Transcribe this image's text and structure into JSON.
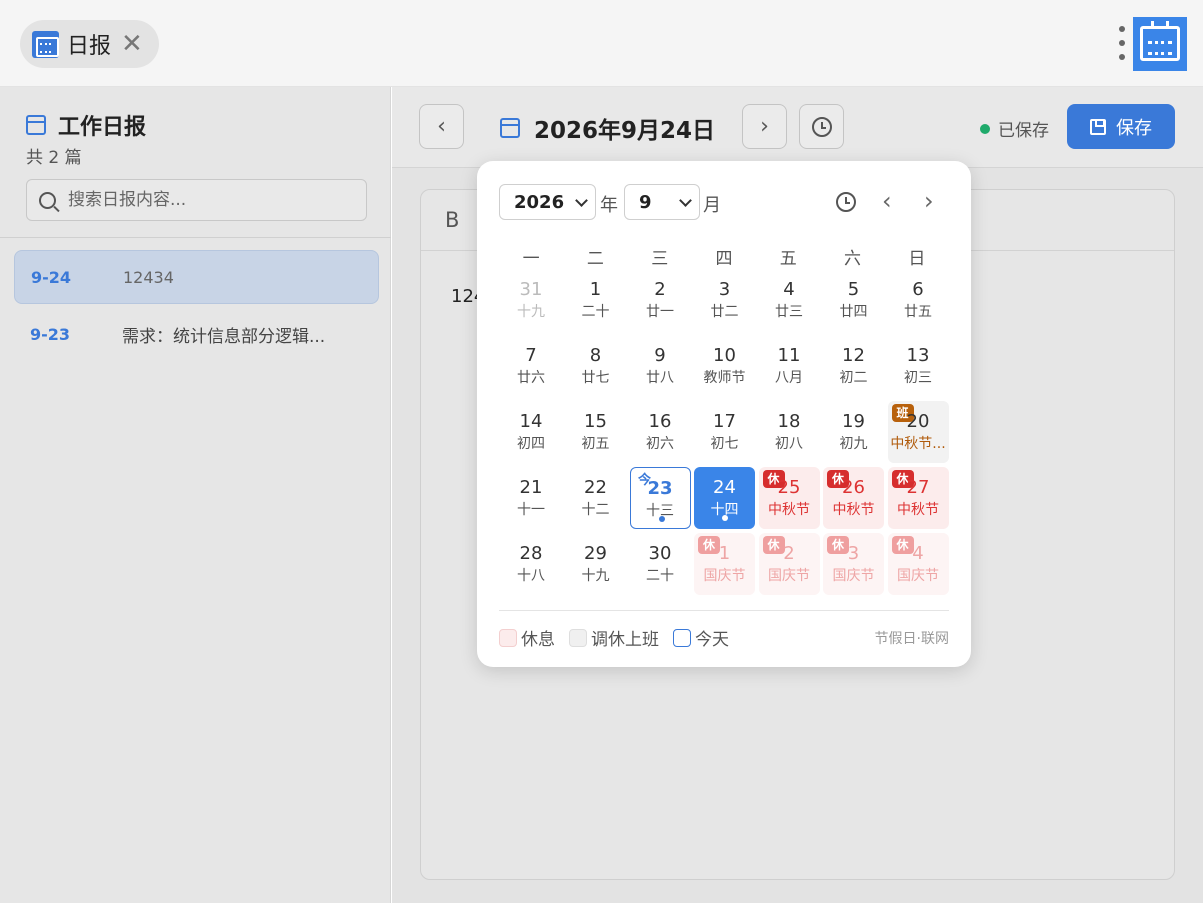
{
  "titlebar": {
    "tab_label": "日报",
    "close_glyph": "✕",
    "logo_icon": "calendar-icon"
  },
  "sidebar": {
    "title": "工作日报",
    "count": "共 2 篇",
    "search_placeholder": "搜索日报内容...",
    "items": [
      {
        "date": "9-24",
        "summary": "12434",
        "active": true
      },
      {
        "date": "9-23",
        "summary": "需求：统计信息部分逻辑...",
        "active": false
      }
    ]
  },
  "toolbar": {
    "prev_glyph": "‹",
    "next_glyph": "›",
    "current_date": "2026年9月24日",
    "saved_status": "已保存",
    "save_label": "保存"
  },
  "editor": {
    "bold_button": "B",
    "content_preview": "124"
  },
  "calendar": {
    "year": "2026",
    "year_unit": "年",
    "month": "9",
    "month_unit": "月",
    "prev_glyph": "‹",
    "next_glyph": "›",
    "weekdays": [
      "一",
      "二",
      "三",
      "四",
      "五",
      "六",
      "日"
    ],
    "weeks": [
      [
        {
          "n": "31",
          "l": "十九",
          "type": "other"
        },
        {
          "n": "1",
          "l": "二十"
        },
        {
          "n": "2",
          "l": "廿一"
        },
        {
          "n": "3",
          "l": "廿二"
        },
        {
          "n": "4",
          "l": "廿三"
        },
        {
          "n": "5",
          "l": "廿四"
        },
        {
          "n": "6",
          "l": "廿五"
        }
      ],
      [
        {
          "n": "7",
          "l": "廿六"
        },
        {
          "n": "8",
          "l": "廿七"
        },
        {
          "n": "9",
          "l": "廿八"
        },
        {
          "n": "10",
          "l": "教师节"
        },
        {
          "n": "11",
          "l": "八月"
        },
        {
          "n": "12",
          "l": "初二"
        },
        {
          "n": "13",
          "l": "初三"
        }
      ],
      [
        {
          "n": "14",
          "l": "初四"
        },
        {
          "n": "15",
          "l": "初五"
        },
        {
          "n": "16",
          "l": "初六"
        },
        {
          "n": "17",
          "l": "初七"
        },
        {
          "n": "18",
          "l": "初八"
        },
        {
          "n": "19",
          "l": "初九"
        },
        {
          "n": "20",
          "l": "中秋节...",
          "type": "work",
          "badge": "班"
        }
      ],
      [
        {
          "n": "21",
          "l": "十一"
        },
        {
          "n": "22",
          "l": "十二"
        },
        {
          "n": "23",
          "l": "十三",
          "type": "today",
          "badge": "今",
          "dot": true
        },
        {
          "n": "24",
          "l": "十四",
          "type": "sel-day",
          "dot": true
        },
        {
          "n": "25",
          "l": "中秋节",
          "type": "rest",
          "badge": "休"
        },
        {
          "n": "26",
          "l": "中秋节",
          "type": "rest",
          "badge": "休"
        },
        {
          "n": "27",
          "l": "中秋节",
          "type": "rest",
          "badge": "休"
        }
      ],
      [
        {
          "n": "28",
          "l": "十八"
        },
        {
          "n": "29",
          "l": "十九"
        },
        {
          "n": "30",
          "l": "二十"
        },
        {
          "n": "1",
          "l": "国庆节",
          "type": "rest-next",
          "badge": "休"
        },
        {
          "n": "2",
          "l": "国庆节",
          "type": "rest-next",
          "badge": "休"
        },
        {
          "n": "3",
          "l": "国庆节",
          "type": "rest-next",
          "badge": "休"
        },
        {
          "n": "4",
          "l": "国庆节",
          "type": "rest-next",
          "badge": "休"
        }
      ]
    ],
    "legend": {
      "rest": "休息",
      "work": "调休上班",
      "today": "今天",
      "credit": "节假日·联网"
    },
    "colors": {
      "accent": "#3a79d8",
      "rest_badge": "#d62d2d",
      "work_badge": "#b8610c",
      "saved_dot": "#1faa6b"
    }
  }
}
